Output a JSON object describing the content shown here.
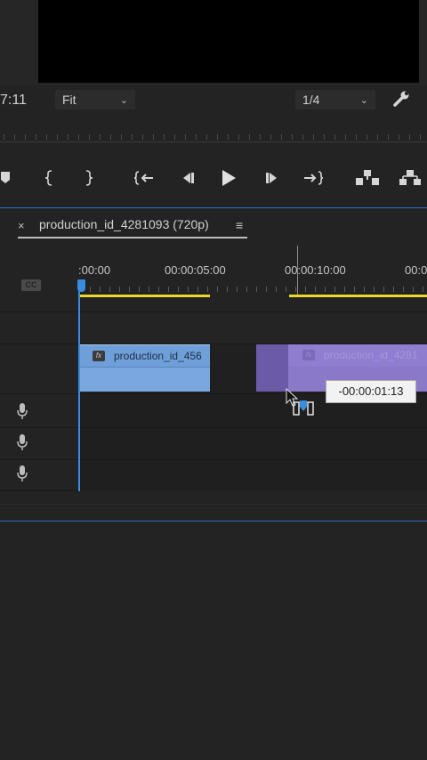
{
  "monitor": {
    "timecode": "7:11",
    "zoom": {
      "value": "Fit"
    },
    "resolution": {
      "value": "1/4"
    }
  },
  "timeline": {
    "tab_close": "×",
    "sequence_name": "production_id_4281093 (720p)",
    "menu_glyph": "≡",
    "ruler_labels": [
      ":00:00",
      "00:00:05:00",
      "00:00:10:00",
      "00:0"
    ],
    "cc_badge": "CC",
    "clips": [
      {
        "name": "production_id_456",
        "badge": "fx",
        "color": "#7aa7e0"
      },
      {
        "name": "production_id_4281",
        "badge": "fx",
        "color": "#8a78c9"
      }
    ],
    "drag_tooltip": "-00:00:01:13"
  },
  "colors": {
    "playhead": "#3a8dde",
    "work_area": "#e8d92a",
    "panel_focus_border": "#2f6fbf"
  },
  "icons": {
    "wrench": "wrench-icon",
    "mic": "microphone-icon",
    "cursor": "insert-drag-cursor-icon"
  }
}
